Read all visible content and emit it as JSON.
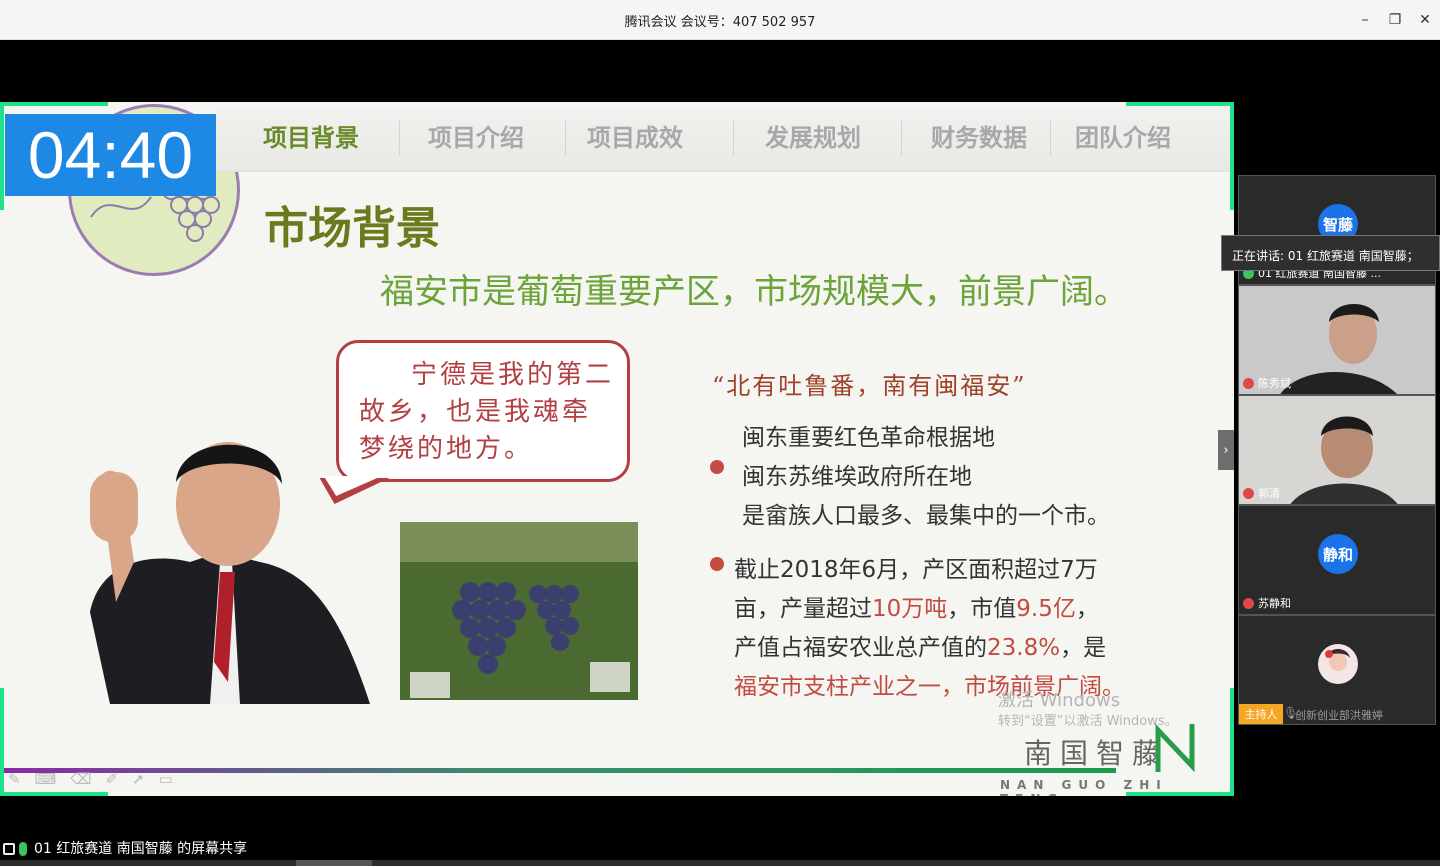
{
  "window": {
    "title": "腾讯会议 会议号：407 502 957",
    "minimize": "–",
    "maximize": "❐",
    "close": "✕"
  },
  "slide": {
    "timer": "04:40",
    "nav": [
      "项目背景",
      "项目介绍",
      "项目成效",
      "发展规划",
      "财务数据",
      "团队介绍"
    ],
    "title": "市场背景",
    "subtitle": "福安市是葡萄重要产区，市场规模大，前景广阔。",
    "speech": "宁德是我的第二故乡，也是我魂牵梦绕的地方。",
    "quote": "“北有吐鲁番，南有闽福安”",
    "lines_1": [
      "闽东重要红色革命根据地",
      "闽东苏维埃政府所在地",
      "是畲族人口最多、最集中的一个市。"
    ],
    "line_2a": "截止2018年6月，产区面积超过7万",
    "line_2b_pre": "亩，产量超过",
    "line_2b_red1": "10万吨",
    "line_2b_mid": "，市值",
    "line_2b_red2": "9.5亿",
    "line_2b_post": "，",
    "line_2c_pre": "产值占福安农业总产值的",
    "line_2c_red": "23.8%",
    "line_2c_post": "，是",
    "line_2d": "福安市支柱产业之一，市场前景广阔。",
    "brand_cn": "南国智藤",
    "brand_en": "NAN GUO ZHI TENG",
    "watermark_title": "激活 Windows",
    "watermark_sub": "转到“设置”以激活 Windows。"
  },
  "participants": {
    "speaking": "正在讲话: 01 红旅赛道 南国智藤；",
    "tiles": [
      {
        "avatar": "智藤",
        "name": "01 红旅赛道 南国智藤 ..."
      },
      {
        "name": "陈秀斌"
      },
      {
        "name": "郭清"
      },
      {
        "avatar": "静和",
        "name": "苏静和"
      },
      {
        "name": ""
      }
    ],
    "host_badge": "主持人",
    "host_name": "创新创业部洪雅婷"
  },
  "status": {
    "share_text": "01 红旅赛道 南国智藤 的屏幕共享"
  },
  "colors": {
    "bracket": "#1de28a",
    "timer_bg": "#1e88e5",
    "accent_green": "#6b8a2a",
    "accent_red": "#c24b42",
    "avatar_blue": "#1a73e8",
    "host_orange": "#f5a623"
  }
}
